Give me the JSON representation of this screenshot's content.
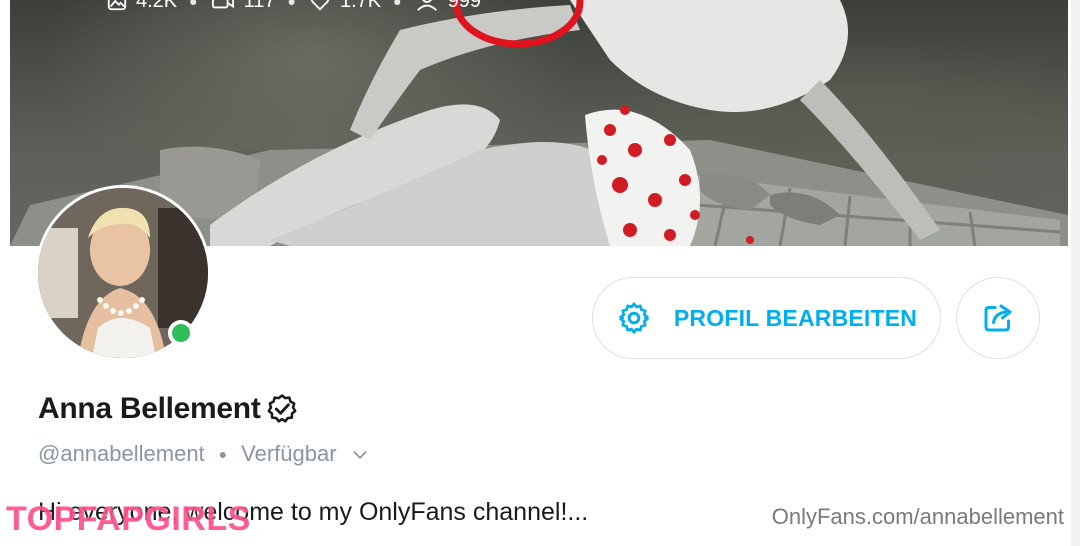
{
  "stats": {
    "photos": "4.2K",
    "videos": "117",
    "likes": "1.7K",
    "subscribers": "999"
  },
  "profile": {
    "name": "Anna Bellement",
    "handle": "@annabellement",
    "status": "Verfügbar",
    "bio": "Hi everyone, welcome to my OnlyFans channel!..."
  },
  "buttons": {
    "edit_label": "PROFIL BEARBEITEN"
  },
  "watermark": {
    "text": "TOPFAPGIRLS",
    "url": "OnlyFans.com/annabellement"
  },
  "colors": {
    "accent": "#00aff0",
    "online": "#2ebd59",
    "annotation_circle": "#e0141e",
    "watermark": "#ff4f8a"
  },
  "icons": [
    "image-icon",
    "video-icon",
    "heart-icon",
    "subscribers-icon",
    "gear-icon",
    "share-icon",
    "verified-icon",
    "chevron-down-icon"
  ]
}
